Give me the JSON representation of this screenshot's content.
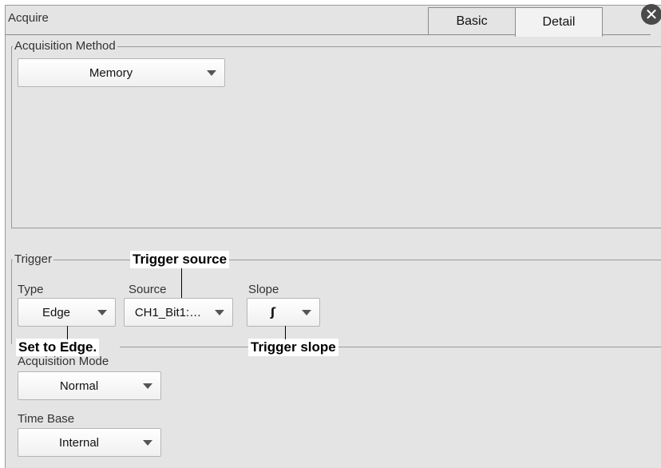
{
  "window": {
    "title": "Acquire"
  },
  "tabs": [
    {
      "label": "Basic",
      "active": false
    },
    {
      "label": "Detail",
      "active": true
    }
  ],
  "acquisition_method": {
    "group_label": "Acquisition Method",
    "value": "Memory"
  },
  "trigger": {
    "group_label": "Trigger",
    "type": {
      "label": "Type",
      "value": "Edge"
    },
    "source": {
      "label": "Source",
      "value": "CH1_Bit1:…"
    },
    "slope": {
      "label": "Slope",
      "value_icon": "rising-edge-icon",
      "glyph": "ʃ"
    }
  },
  "acquisition_mode": {
    "label": "Acquisition Mode",
    "value": "Normal"
  },
  "time_base": {
    "label": "Time Base",
    "value": "Internal"
  },
  "callouts": {
    "trigger_source": "Trigger source",
    "set_to_edge": "Set to Edge.",
    "trigger_slope": "Trigger slope"
  }
}
